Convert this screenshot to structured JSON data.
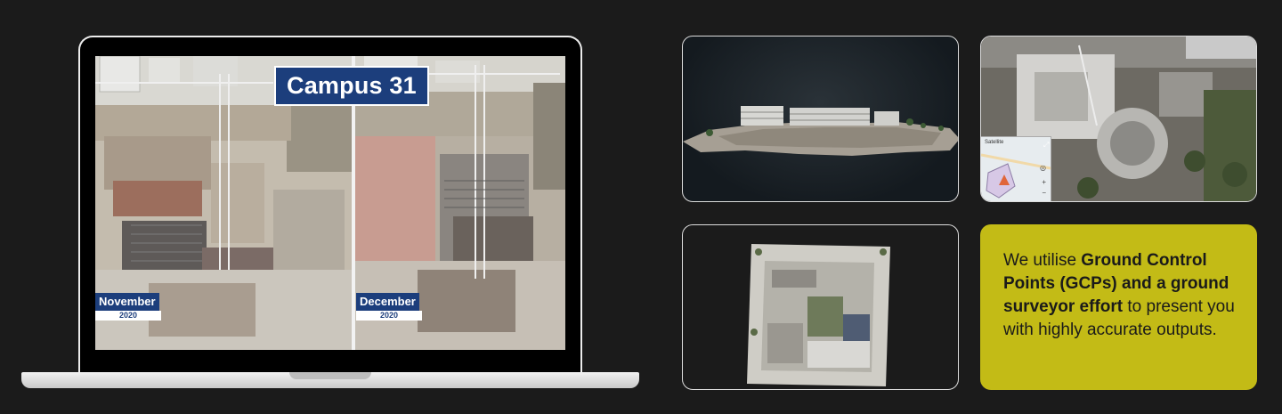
{
  "laptop": {
    "title": "Campus 31",
    "panels": [
      {
        "month": "November",
        "year": "2020"
      },
      {
        "month": "December",
        "year": "2020"
      }
    ]
  },
  "tiles": {
    "model": {
      "icon": "3d-model-image"
    },
    "aerial": {
      "map_label": "Satellite",
      "icon": "aerial-photo-image"
    },
    "ortho": {
      "icon": "orthomosaic-image"
    }
  },
  "info": {
    "p1": "We utilise ",
    "b1": "Ground Control Points (GCPs) and a ground surveyor effort",
    "p2": " to present you with highly accurate outputs."
  },
  "colors": {
    "background": "#1b1b1b",
    "accent": "#c3bb16",
    "badge_blue": "#1c3e7c"
  }
}
